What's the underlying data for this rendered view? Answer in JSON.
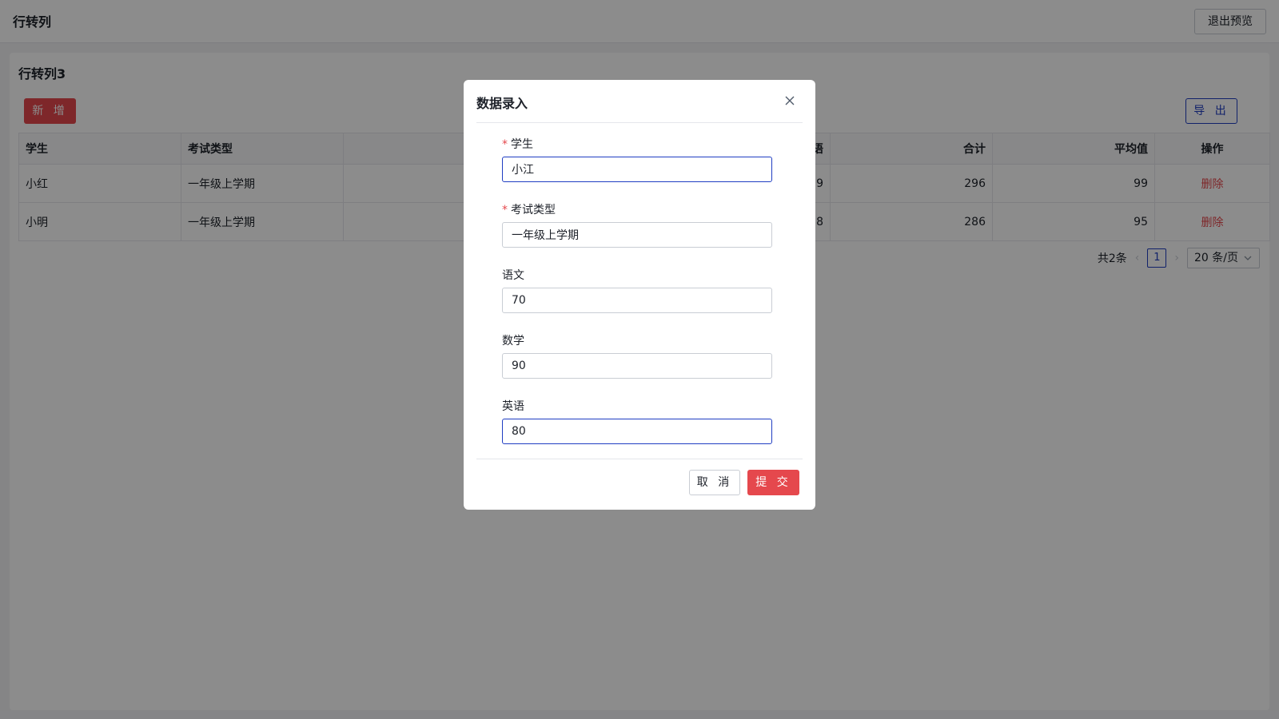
{
  "header": {
    "title": "行转列",
    "exit_label": "退出预览"
  },
  "card": {
    "title": "行转列3",
    "add_label": "新 增",
    "export_label": "导 出"
  },
  "table": {
    "columns": [
      "学生",
      "考试类型",
      "英语",
      "合计",
      "平均值",
      "操作"
    ],
    "rows": [
      {
        "student": "小红",
        "exam": "一年级上学期",
        "english": "99",
        "total": "296",
        "avg": "99",
        "action": "删除"
      },
      {
        "student": "小明",
        "exam": "一年级上学期",
        "english": "88",
        "total": "286",
        "avg": "95",
        "action": "删除"
      }
    ]
  },
  "pagination": {
    "total_text": "共2条",
    "current_page": "1",
    "page_size": "20 条/页"
  },
  "modal": {
    "title": "数据录入",
    "fields": [
      {
        "label": "学生",
        "required": true,
        "value": "小江"
      },
      {
        "label": "考试类型",
        "required": true,
        "value": "一年级上学期"
      },
      {
        "label": "语文",
        "required": false,
        "value": "70"
      },
      {
        "label": "数学",
        "required": false,
        "value": "90"
      },
      {
        "label": "英语",
        "required": false,
        "value": "80"
      }
    ],
    "cancel_label": "取 消",
    "submit_label": "提 交"
  },
  "colors": {
    "primary": "#1f3dc2",
    "danger": "#e5484d"
  }
}
